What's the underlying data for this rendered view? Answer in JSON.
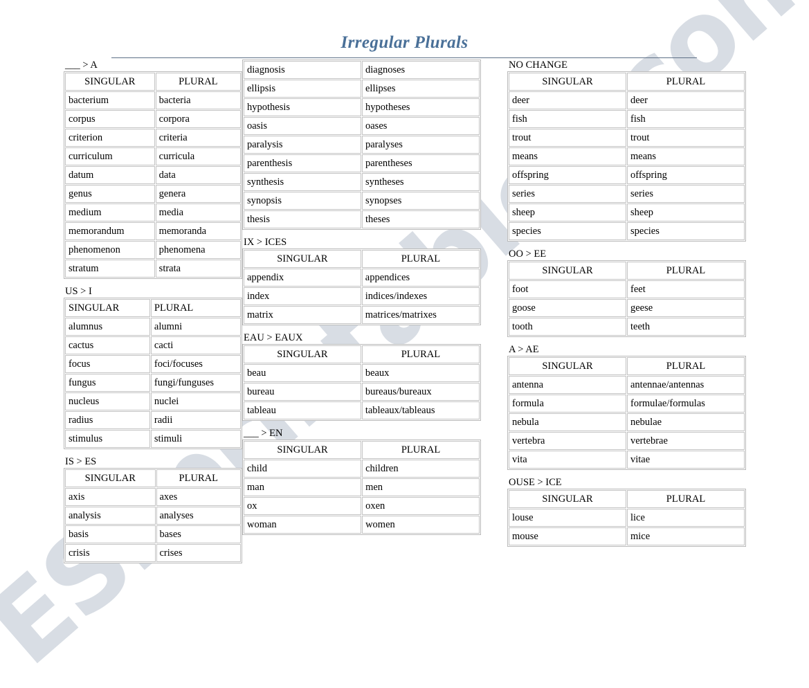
{
  "title": "Irregular Plurals",
  "watermark": "ESLprintables.com",
  "headers": {
    "singular": "SINGULAR",
    "plural": "PLURAL"
  },
  "columns": [
    {
      "id": "column-left",
      "sections": [
        {
          "id": "section-to-a",
          "heading": "___ > A",
          "show_header": true,
          "header_align": "center",
          "rows": [
            [
              "bacterium",
              "bacteria"
            ],
            [
              "corpus",
              "corpora"
            ],
            [
              "criterion",
              "criteria"
            ],
            [
              "curriculum",
              "curricula"
            ],
            [
              "datum",
              "data"
            ],
            [
              "genus",
              "genera"
            ],
            [
              "medium",
              "media"
            ],
            [
              "memorandum",
              "memoranda"
            ],
            [
              "phenomenon",
              "phenomena"
            ],
            [
              "stratum",
              "strata"
            ]
          ]
        },
        {
          "id": "section-us-to-i",
          "heading": "US > I",
          "show_header": true,
          "header_align": "left",
          "rows": [
            [
              "alumnus",
              "alumni"
            ],
            [
              "cactus",
              "cacti"
            ],
            [
              "focus",
              "foci/focuses"
            ],
            [
              "fungus",
              "fungi/funguses"
            ],
            [
              "nucleus",
              "nuclei"
            ],
            [
              "radius",
              "radii"
            ],
            [
              "stimulus",
              "stimuli"
            ]
          ]
        },
        {
          "id": "section-is-to-es",
          "heading": "IS > ES",
          "show_header": true,
          "header_align": "center",
          "rows": [
            [
              "axis",
              "axes"
            ],
            [
              "analysis",
              "analyses"
            ],
            [
              "basis",
              "bases"
            ],
            [
              "crisis",
              "crises"
            ]
          ]
        }
      ]
    },
    {
      "id": "column-middle",
      "sections": [
        {
          "id": "section-is-to-es-continued",
          "heading": "",
          "show_header": false,
          "header_align": "center",
          "rows": [
            [
              "diagnosis",
              "diagnoses"
            ],
            [
              "ellipsis",
              "ellipses"
            ],
            [
              "hypothesis",
              "hypotheses"
            ],
            [
              "oasis",
              "oases"
            ],
            [
              "paralysis",
              "paralyses"
            ],
            [
              "parenthesis",
              "parentheses"
            ],
            [
              "synthesis",
              "syntheses"
            ],
            [
              "synopsis",
              "synopses"
            ],
            [
              "thesis",
              "theses"
            ]
          ]
        },
        {
          "id": "section-ix-to-ices",
          "heading": "IX > ICES",
          "show_header": true,
          "header_align": "center",
          "rows": [
            [
              "appendix",
              "appendices"
            ],
            [
              "index",
              "indices/indexes"
            ],
            [
              "matrix",
              "matrices/matrixes"
            ]
          ]
        },
        {
          "id": "section-eau-to-eaux",
          "heading": "EAU > EAUX",
          "show_header": true,
          "header_align": "center",
          "rows": [
            [
              "beau",
              "beaux"
            ],
            [
              "bureau",
              "bureaus/bureaux"
            ],
            [
              "tableau",
              "tableaux/tableaus"
            ]
          ]
        },
        {
          "id": "section-to-en",
          "heading": "___ > EN",
          "show_header": true,
          "header_align": "center",
          "rows": [
            [
              "child",
              "children"
            ],
            [
              "man",
              "men"
            ],
            [
              "ox",
              "oxen"
            ],
            [
              "woman",
              "women"
            ]
          ]
        }
      ]
    },
    {
      "id": "column-right",
      "sections": [
        {
          "id": "section-no-change",
          "heading": "NO CHANGE",
          "show_header": true,
          "header_align": "center",
          "rows": [
            [
              "deer",
              "deer"
            ],
            [
              "fish",
              "fish"
            ],
            [
              "trout",
              "trout"
            ],
            [
              "means",
              "means"
            ],
            [
              "offspring",
              "offspring"
            ],
            [
              "series",
              "series"
            ],
            [
              "sheep",
              "sheep"
            ],
            [
              "species",
              "species"
            ]
          ]
        },
        {
          "id": "section-oo-to-ee",
          "heading": "OO > EE",
          "show_header": true,
          "header_align": "center",
          "rows": [
            [
              "foot",
              "feet"
            ],
            [
              "goose",
              "geese"
            ],
            [
              "tooth",
              "teeth"
            ]
          ]
        },
        {
          "id": "section-a-to-ae",
          "heading": "A > AE",
          "show_header": true,
          "header_align": "center",
          "rows": [
            [
              "antenna",
              "antennae/antennas"
            ],
            [
              "formula",
              "formulae/formulas"
            ],
            [
              "nebula",
              "nebulae"
            ],
            [
              "vertebra",
              "vertebrae"
            ],
            [
              "vita",
              "vitae"
            ]
          ]
        },
        {
          "id": "section-ouse-to-ice",
          "heading": "OUSE > ICE",
          "show_header": true,
          "header_align": "center",
          "rows": [
            [
              "louse",
              "lice"
            ],
            [
              "mouse",
              "mice"
            ]
          ]
        }
      ]
    }
  ],
  "colors": {
    "title": "#4a7098",
    "rule": "#5d6f86",
    "table_border": "#b9b9b9",
    "cell_border": "#c3c3c3",
    "watermark": "#d8dde4"
  }
}
